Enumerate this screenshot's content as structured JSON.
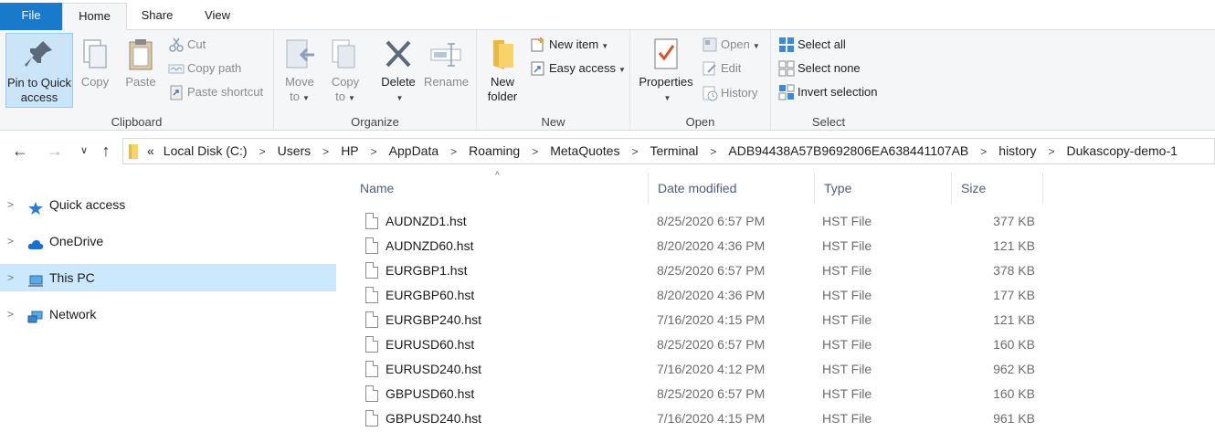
{
  "tabs": {
    "file": "File",
    "home": "Home",
    "share": "Share",
    "view": "View"
  },
  "clipboard": {
    "label": "Clipboard",
    "pin": [
      "Pin to Quick",
      "access"
    ],
    "copy": "Copy",
    "paste": "Paste",
    "cut": "Cut",
    "copy_path": "Copy path",
    "paste_shortcut": "Paste shortcut"
  },
  "organize": {
    "label": "Organize",
    "move_to": [
      "Move",
      "to"
    ],
    "copy_to": [
      "Copy",
      "to"
    ],
    "delete": "Delete",
    "rename": "Rename"
  },
  "new": {
    "label": "New",
    "new_folder": [
      "New",
      "folder"
    ],
    "new_item": "New item",
    "easy_access": "Easy access"
  },
  "open": {
    "label": "Open",
    "properties": "Properties",
    "open": "Open",
    "edit": "Edit",
    "history": "History"
  },
  "select": {
    "label": "Select",
    "select_all": "Select all",
    "select_none": "Select none",
    "invert_selection": "Invert selection"
  },
  "address": {
    "overflow": "«",
    "crumbs": [
      "Local Disk (C:)",
      "Users",
      "HP",
      "AppData",
      "Roaming",
      "MetaQuotes",
      "Terminal",
      "ADB94438A57B9692806EA638441107AB",
      "history",
      "Dukascopy-demo-1"
    ]
  },
  "navpane": {
    "items": [
      {
        "label": "Quick access",
        "icon": "star-icon"
      },
      {
        "label": "OneDrive",
        "icon": "cloud-icon"
      },
      {
        "label": "This PC",
        "icon": "computer-icon",
        "selected": true
      },
      {
        "label": "Network",
        "icon": "network-icon"
      }
    ]
  },
  "columns": {
    "name": "Name",
    "date": "Date modified",
    "type": "Type",
    "size": "Size"
  },
  "files": [
    {
      "name": "AUDNZD1.hst",
      "date": "8/25/2020 6:57 PM",
      "type": "HST File",
      "size": "377 KB"
    },
    {
      "name": "AUDNZD60.hst",
      "date": "8/20/2020 4:36 PM",
      "type": "HST File",
      "size": "121 KB"
    },
    {
      "name": "EURGBP1.hst",
      "date": "8/25/2020 6:57 PM",
      "type": "HST File",
      "size": "378 KB"
    },
    {
      "name": "EURGBP60.hst",
      "date": "8/20/2020 4:36 PM",
      "type": "HST File",
      "size": "177 KB"
    },
    {
      "name": "EURGBP240.hst",
      "date": "7/16/2020 4:15 PM",
      "type": "HST File",
      "size": "121 KB"
    },
    {
      "name": "EURUSD60.hst",
      "date": "8/25/2020 6:57 PM",
      "type": "HST File",
      "size": "160 KB"
    },
    {
      "name": "EURUSD240.hst",
      "date": "7/16/2020 4:12 PM",
      "type": "HST File",
      "size": "962 KB"
    },
    {
      "name": "GBPUSD60.hst",
      "date": "8/25/2020 6:57 PM",
      "type": "HST File",
      "size": "160 KB"
    },
    {
      "name": "GBPUSD240.hst",
      "date": "7/16/2020 4:15 PM",
      "type": "HST File",
      "size": "961 KB"
    }
  ],
  "colors": {
    "file_tab": "#1979ca",
    "selected": "#cce8ff",
    "ribbon": "#f5f6f7"
  }
}
